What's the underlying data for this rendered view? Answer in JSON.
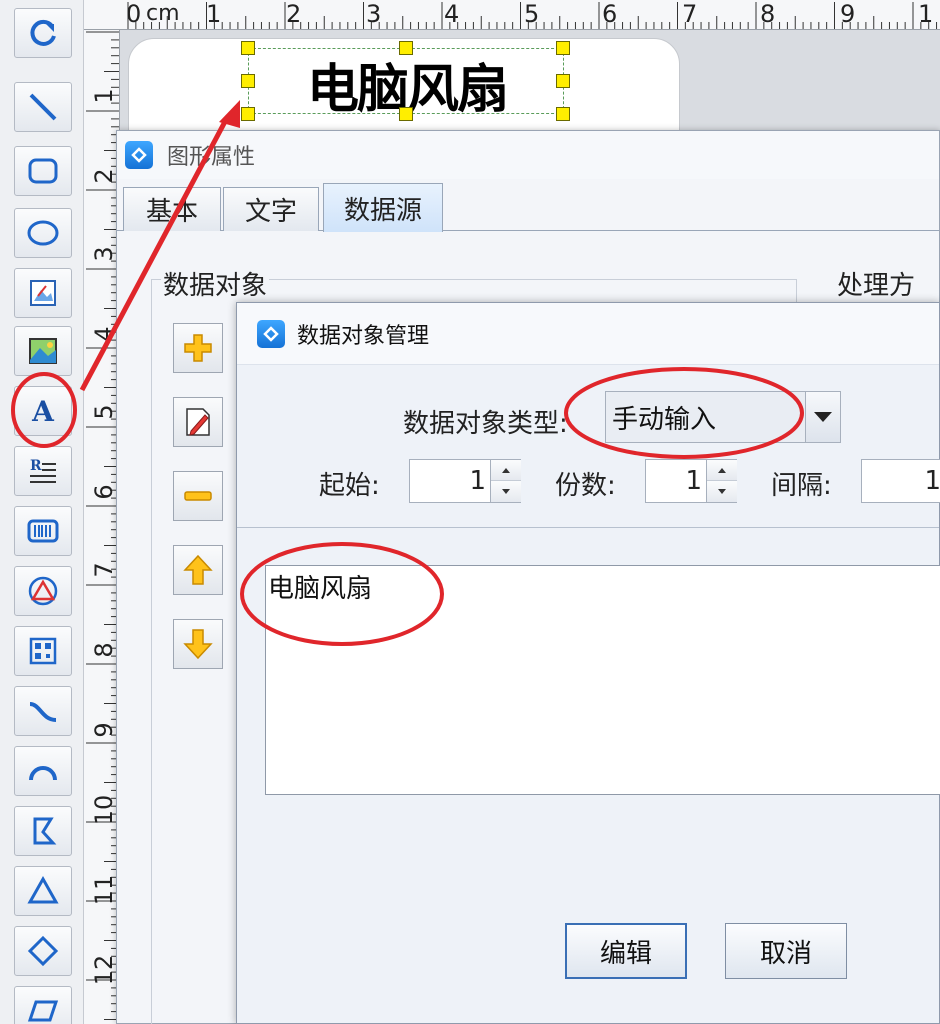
{
  "ruler": {
    "unit": "cm",
    "top_numbers": [
      "0",
      "1",
      "2",
      "3",
      "4",
      "5",
      "6",
      "7",
      "8",
      "9",
      "1"
    ],
    "left_numbers": [
      "1",
      "2",
      "3",
      "4",
      "5",
      "6",
      "7",
      "8",
      "9",
      "10",
      "11",
      "12"
    ]
  },
  "toolbar": {
    "tools": [
      {
        "name": "rotate-tool",
        "icon": "rotate-icon"
      },
      {
        "name": "line-tool",
        "icon": "line-icon"
      },
      {
        "name": "rounded-rect-tool",
        "icon": "rounded-rectangle-icon"
      },
      {
        "name": "ellipse-tool",
        "icon": "ellipse-icon"
      },
      {
        "name": "picture-tool",
        "icon": "picture-icon"
      },
      {
        "name": "image-tool",
        "icon": "image-icon"
      },
      {
        "name": "text-tool",
        "icon": "text-a-icon",
        "letter": "A"
      },
      {
        "name": "rich-text-tool",
        "icon": "rich-text-icon"
      },
      {
        "name": "barcode-tool",
        "icon": "barcode-icon"
      },
      {
        "name": "shape-tool",
        "icon": "triangle-circle-icon"
      },
      {
        "name": "qrcode-tool",
        "icon": "qrcode-icon"
      },
      {
        "name": "curve-tool",
        "icon": "curve-icon"
      },
      {
        "name": "arc-tool",
        "icon": "arc-icon"
      },
      {
        "name": "polyline-tool",
        "icon": "polyline-icon"
      },
      {
        "name": "triangle-tool",
        "icon": "triangle-icon"
      },
      {
        "name": "diamond-tool",
        "icon": "diamond-icon"
      },
      {
        "name": "parallelogram-tool",
        "icon": "parallelogram-icon"
      }
    ]
  },
  "label": {
    "text": "电脑风扇"
  },
  "properties_dialog": {
    "title": "图形属性",
    "tabs": [
      "基本",
      "文字",
      "数据源"
    ],
    "active_tab": "数据源",
    "data_object_label": "数据对象",
    "processing_label": "处理方法",
    "side_buttons": [
      "add-icon",
      "edit-icon",
      "remove-icon",
      "move-up-icon",
      "move-down-icon"
    ]
  },
  "data_object_dialog": {
    "title": "数据对象管理",
    "type_label": "数据对象类型:",
    "type_value": "手动输入",
    "start_label": "起始:",
    "start_value": "1",
    "copies_label": "份数:",
    "copies_value": "1",
    "interval_label": "间隔:",
    "interval_value": "1",
    "content": "电脑风扇",
    "edit_button": "编辑",
    "cancel_button": "取消"
  },
  "colors": {
    "annotation_red": "#e0262b",
    "handle_yellow": "#ffee00",
    "accent_blue": "#1a4fa3"
  }
}
